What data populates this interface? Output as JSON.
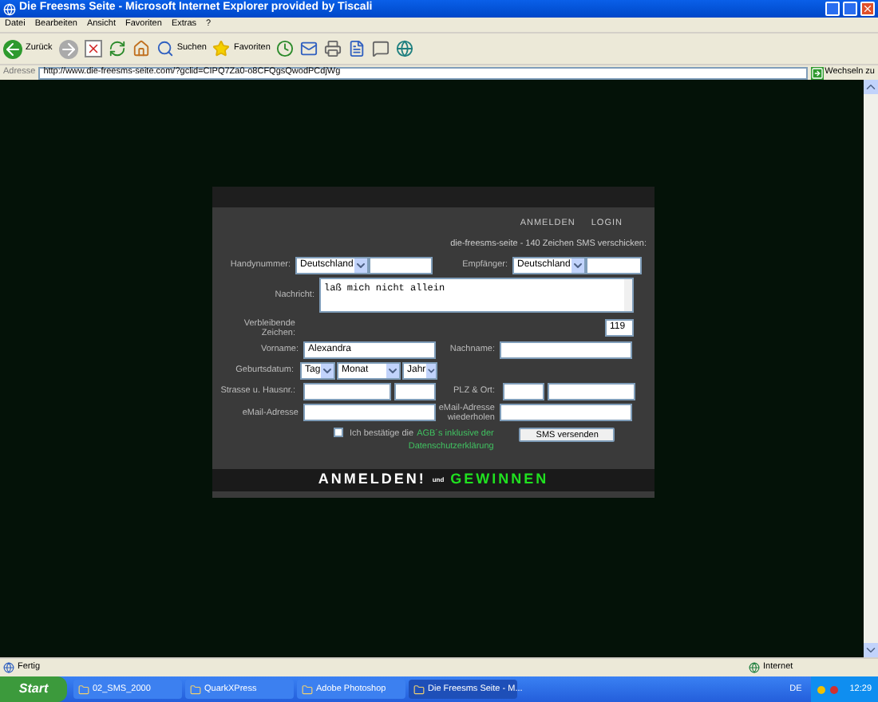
{
  "window": {
    "title": "Die Freesms Seite - Microsoft Internet Explorer provided by Tiscali"
  },
  "menu": [
    "Datei",
    "Bearbeiten",
    "Ansicht",
    "Favoriten",
    "Extras",
    "?"
  ],
  "toolbar": {
    "back": "Zurück",
    "search": "Suchen",
    "favorites": "Favoriten"
  },
  "address": {
    "label": "Adresse",
    "url": "http://www.die-freesms-seite.com/?gclid=CIPQ7Za0-o8CFQgsQwodPCdjWg",
    "go": "Wechseln zu"
  },
  "form": {
    "nav": [
      "ANMELDEN",
      "LOGIN"
    ],
    "heading": "die-freesms-seite - 140 Zeichen SMS verschicken:",
    "phone_label": "Handynummer:",
    "phone_country": "Deutschland",
    "recipient_label": "Empfänger:",
    "recipient_country": "Deutschland",
    "message_label": "Nachricht:",
    "message": "laß mich nicht allein",
    "remaining_label": "Verbleibende Zeichen:",
    "remaining": "119",
    "firstname_label": "Vorname:",
    "firstname": "Alexandra",
    "lastname_label": "Nachname:",
    "birth_label": "Geburtsdatum:",
    "birth_selects": [
      "Tag",
      "Monat",
      "Jahr"
    ],
    "street_label": "Strasse u. Hausnr.:",
    "zip_label": "PLZ & Ort:",
    "email_label": "eMail-Adresse",
    "email2_label": "eMail-Adresse wiederholen",
    "agree": {
      "checked": false,
      "text": "Ich bestätige die",
      "links": [
        "AGB´s inklusive der",
        "Datenschutzerklärung"
      ]
    },
    "submit": "SMS versenden",
    "banner": {
      "left": "ANMELDEN!",
      "middle": "und",
      "right": "GEWINNEN"
    }
  },
  "status_bar": {
    "text": "Fertig",
    "zone": "Internet"
  },
  "taskbar": {
    "start": "Start",
    "tasks": [
      {
        "label": "02_SMS_2000",
        "selected": false
      },
      {
        "label": "QuarkXPress",
        "selected": false
      },
      {
        "label": "Adobe Photoshop",
        "selected": false
      },
      {
        "label": "Die Freesms Seite - M...",
        "selected": true
      }
    ],
    "language": "DE",
    "clock": "12:29"
  }
}
